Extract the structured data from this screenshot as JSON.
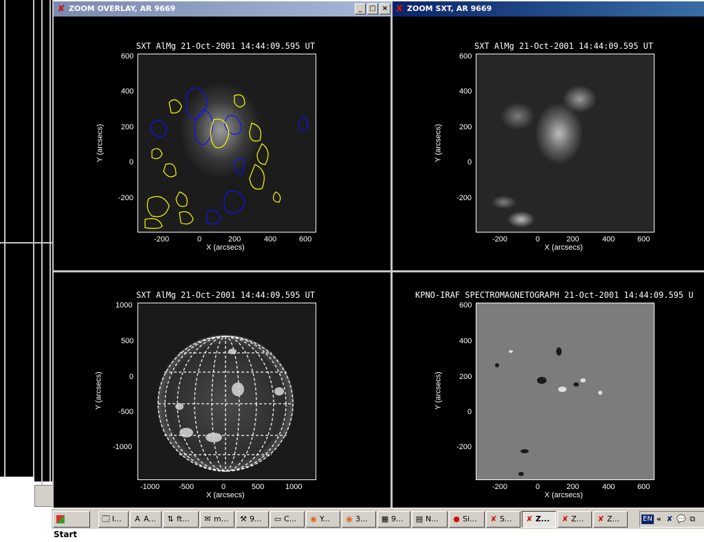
{
  "windows": {
    "overlay": {
      "title": "ZOOM OVERLAY, AR 9669",
      "plot": {
        "title": "SXT AlMg 21-Oct-2001  14:44:09.595 UT",
        "xlabel": "X (arcsecs)",
        "ylabel": "Y (arcsecs)",
        "xticks": [
          "-200",
          "0",
          "200",
          "400",
          "600"
        ],
        "yticks": [
          "600",
          "400",
          "200",
          "0",
          "-200"
        ]
      },
      "contour_colors": {
        "positive": "#ffff00",
        "negative": "#1010ff"
      }
    },
    "zoom_sxt": {
      "title": "ZOOM SXT, AR 9669",
      "plot": {
        "title": "SXT AlMg 21-Oct-2001  14:44:09.595 UT",
        "xlabel": "X (arcsecs)",
        "ylabel": "Y (arcsecs)",
        "xticks": [
          "-200",
          "0",
          "200",
          "400",
          "600"
        ],
        "yticks": [
          "600",
          "400",
          "200",
          "0",
          "-200"
        ]
      }
    },
    "full_disk": {
      "plot": {
        "title": "SXT AlMg 21-Oct-2001  14:44:09.595 UT",
        "xlabel": "X (arcsecs)",
        "ylabel": "Y (arcsecs)",
        "xticks": [
          "-1000",
          "-500",
          "0",
          "500",
          "1000"
        ],
        "yticks": [
          "1000",
          "500",
          "0",
          "-500",
          "-1000"
        ]
      }
    },
    "magnetogram": {
      "plot": {
        "title": "KPNO-IRAF SPECTROMAGNETOGRAPH 21-Oct-2001  14:44:09.595 U",
        "xlabel": "X (arcsecs)",
        "ylabel": "Y (arcsecs)",
        "xticks": [
          "-200",
          "0",
          "200",
          "400",
          "600"
        ],
        "yticks": [
          "600",
          "400",
          "200",
          "0",
          "-200"
        ]
      }
    }
  },
  "window_buttons": {
    "minimize": "_",
    "maximize": "□",
    "close": "×"
  },
  "taskbar": {
    "start_label": "Start",
    "tasks": [
      {
        "icon": "explorer-icon",
        "glyph": "🗔",
        "label": "I..."
      },
      {
        "icon": "app-a-icon",
        "glyph": "A",
        "label": "A..."
      },
      {
        "icon": "ftp-icon",
        "glyph": "⇅",
        "label": "ft..."
      },
      {
        "icon": "chat-icon",
        "glyph": "✉",
        "label": "m..."
      },
      {
        "icon": "tool-icon",
        "glyph": "⚒",
        "label": "9..."
      },
      {
        "icon": "folder-icon",
        "glyph": "▭",
        "label": "C..."
      },
      {
        "icon": "firefox-icon",
        "glyph": "◉",
        "label": "Y..."
      },
      {
        "icon": "firefox-icon",
        "glyph": "◉",
        "label": "3..."
      },
      {
        "icon": "image-icon",
        "glyph": "▦",
        "label": "9..."
      },
      {
        "icon": "notepad-icon",
        "glyph": "▤",
        "label": "N..."
      },
      {
        "icon": "record-icon",
        "glyph": "●",
        "label": "Si..."
      },
      {
        "icon": "idl-x-icon",
        "glyph": "✘",
        "label": "S..."
      },
      {
        "icon": "idl-x-icon",
        "glyph": "✘",
        "label": "Z..."
      },
      {
        "icon": "idl-x-icon",
        "glyph": "✘",
        "label": "Z..."
      },
      {
        "icon": "idl-x-icon",
        "glyph": "✘",
        "label": "Z..."
      }
    ],
    "tray": {
      "lang": "EN",
      "chevron": "«"
    }
  }
}
